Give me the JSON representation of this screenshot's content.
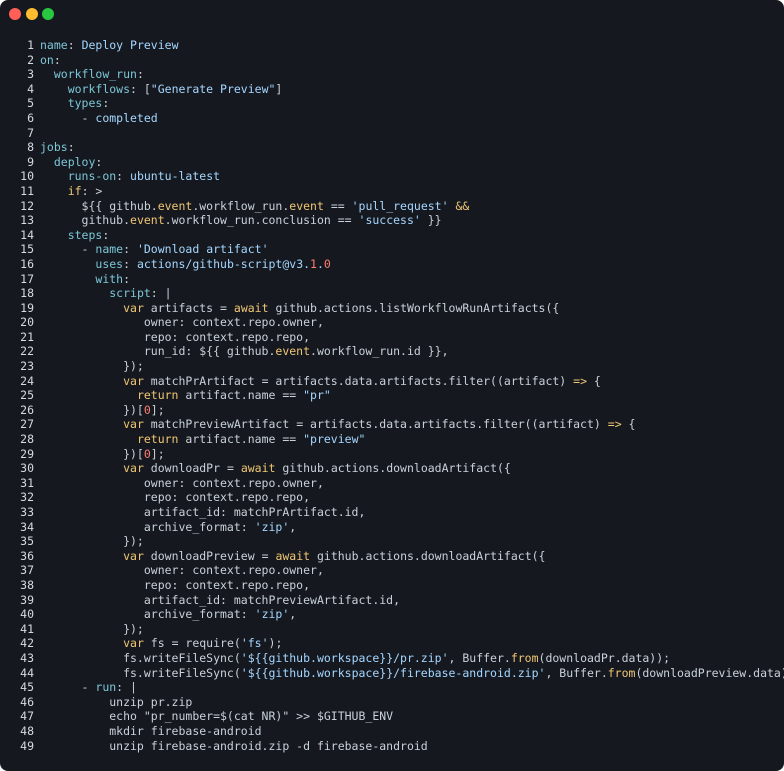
{
  "window": {
    "colors": {
      "background": "#15191f",
      "red": "#ff5f57",
      "yellow": "#febc2e",
      "green": "#28c840"
    }
  },
  "code": {
    "language": "yaml",
    "lines": [
      [
        [
          "k",
          "name"
        ],
        [
          "p",
          ": "
        ],
        [
          "s",
          "Deploy Preview"
        ]
      ],
      [
        [
          "k",
          "on"
        ],
        [
          "p",
          ":"
        ]
      ],
      [
        [
          "p",
          "  "
        ],
        [
          "k",
          "workflow_run"
        ],
        [
          "p",
          ":"
        ]
      ],
      [
        [
          "p",
          "    "
        ],
        [
          "k",
          "workflows"
        ],
        [
          "p",
          ": ["
        ],
        [
          "s",
          "\"Generate Preview\""
        ],
        [
          "p",
          "]"
        ]
      ],
      [
        [
          "p",
          "    "
        ],
        [
          "k",
          "types"
        ],
        [
          "p",
          ":"
        ]
      ],
      [
        [
          "p",
          "      - "
        ],
        [
          "s",
          "completed"
        ]
      ],
      [],
      [
        [
          "k",
          "jobs"
        ],
        [
          "p",
          ":"
        ]
      ],
      [
        [
          "p",
          "  "
        ],
        [
          "k",
          "deploy"
        ],
        [
          "p",
          ":"
        ]
      ],
      [
        [
          "p",
          "    "
        ],
        [
          "k",
          "runs-on"
        ],
        [
          "p",
          ": "
        ],
        [
          "s",
          "ubuntu-latest"
        ]
      ],
      [
        [
          "p",
          "    "
        ],
        [
          "kw",
          "if"
        ],
        [
          "p",
          ": >"
        ]
      ],
      [
        [
          "p",
          "      ${{ github."
        ],
        [
          "kw",
          "event"
        ],
        [
          "p",
          ".workflow_run."
        ],
        [
          "kw",
          "event"
        ],
        [
          "p",
          " == "
        ],
        [
          "s",
          "'pull_request'"
        ],
        [
          "p",
          " "
        ],
        [
          "kw",
          "&&"
        ]
      ],
      [
        [
          "p",
          "      github."
        ],
        [
          "kw",
          "event"
        ],
        [
          "p",
          ".workflow_run.conclusion == "
        ],
        [
          "s",
          "'success'"
        ],
        [
          "p",
          " }}"
        ]
      ],
      [
        [
          "p",
          "    "
        ],
        [
          "k",
          "steps"
        ],
        [
          "p",
          ":"
        ]
      ],
      [
        [
          "p",
          "      - "
        ],
        [
          "k",
          "name"
        ],
        [
          "p",
          ": "
        ],
        [
          "s",
          "'Download artifact'"
        ]
      ],
      [
        [
          "p",
          "        "
        ],
        [
          "k",
          "uses"
        ],
        [
          "p",
          ": "
        ],
        [
          "s",
          "actions/github-script@v3."
        ],
        [
          "n",
          "1"
        ],
        [
          "s",
          "."
        ],
        [
          "n",
          "0"
        ]
      ],
      [
        [
          "p",
          "        "
        ],
        [
          "k",
          "with"
        ],
        [
          "p",
          ":"
        ]
      ],
      [
        [
          "p",
          "          "
        ],
        [
          "k",
          "script"
        ],
        [
          "p",
          ": |"
        ]
      ],
      [
        [
          "p",
          "            "
        ],
        [
          "kw",
          "var"
        ],
        [
          "p",
          " artifacts = "
        ],
        [
          "kw",
          "await"
        ],
        [
          "p",
          " github.actions.listWorkflowRunArtifacts({"
        ]
      ],
      [
        [
          "p",
          "               owner: context.repo.owner,"
        ]
      ],
      [
        [
          "p",
          "               repo: context.repo.repo,"
        ]
      ],
      [
        [
          "p",
          "               run_id: ${{ github."
        ],
        [
          "kw",
          "event"
        ],
        [
          "p",
          ".workflow_run.id }},"
        ]
      ],
      [
        [
          "p",
          "            });"
        ]
      ],
      [
        [
          "p",
          "            "
        ],
        [
          "kw",
          "var"
        ],
        [
          "p",
          " matchPrArtifact = artifacts.data.artifacts.filter((artifact) "
        ],
        [
          "kw",
          "=>"
        ],
        [
          "p",
          " {"
        ]
      ],
      [
        [
          "p",
          "              "
        ],
        [
          "kw",
          "return"
        ],
        [
          "p",
          " artifact.name == "
        ],
        [
          "s",
          "\"pr\""
        ]
      ],
      [
        [
          "p",
          "            })["
        ],
        [
          "n",
          "0"
        ],
        [
          "p",
          "];"
        ]
      ],
      [
        [
          "p",
          "            "
        ],
        [
          "kw",
          "var"
        ],
        [
          "p",
          " matchPreviewArtifact = artifacts.data.artifacts.filter((artifact) "
        ],
        [
          "kw",
          "=>"
        ],
        [
          "p",
          " {"
        ]
      ],
      [
        [
          "p",
          "              "
        ],
        [
          "kw",
          "return"
        ],
        [
          "p",
          " artifact.name == "
        ],
        [
          "s",
          "\"preview\""
        ]
      ],
      [
        [
          "p",
          "            })["
        ],
        [
          "n",
          "0"
        ],
        [
          "p",
          "];"
        ]
      ],
      [
        [
          "p",
          "            "
        ],
        [
          "kw",
          "var"
        ],
        [
          "p",
          " downloadPr = "
        ],
        [
          "kw",
          "await"
        ],
        [
          "p",
          " github.actions.downloadArtifact({"
        ]
      ],
      [
        [
          "p",
          "               owner: context.repo.owner,"
        ]
      ],
      [
        [
          "p",
          "               repo: context.repo.repo,"
        ]
      ],
      [
        [
          "p",
          "               artifact_id: matchPrArtifact.id,"
        ]
      ],
      [
        [
          "p",
          "               archive_format: "
        ],
        [
          "s",
          "'zip'"
        ],
        [
          "p",
          ","
        ]
      ],
      [
        [
          "p",
          "            });"
        ]
      ],
      [
        [
          "p",
          "            "
        ],
        [
          "kw",
          "var"
        ],
        [
          "p",
          " downloadPreview = "
        ],
        [
          "kw",
          "await"
        ],
        [
          "p",
          " github.actions.downloadArtifact({"
        ]
      ],
      [
        [
          "p",
          "               owner: context.repo.owner,"
        ]
      ],
      [
        [
          "p",
          "               repo: context.repo.repo,"
        ]
      ],
      [
        [
          "p",
          "               artifact_id: matchPreviewArtifact.id,"
        ]
      ],
      [
        [
          "p",
          "               archive_format: "
        ],
        [
          "s",
          "'zip'"
        ],
        [
          "p",
          ","
        ]
      ],
      [
        [
          "p",
          "            });"
        ]
      ],
      [
        [
          "p",
          "            "
        ],
        [
          "kw",
          "var"
        ],
        [
          "p",
          " fs = require("
        ],
        [
          "s",
          "'fs'"
        ],
        [
          "p",
          ");"
        ]
      ],
      [
        [
          "p",
          "            fs.writeFileSync("
        ],
        [
          "s",
          "'${{github.workspace}}/pr.zip'"
        ],
        [
          "p",
          ", Buffer."
        ],
        [
          "kw",
          "from"
        ],
        [
          "p",
          "(downloadPr.data));"
        ]
      ],
      [
        [
          "p",
          "            fs.writeFileSync("
        ],
        [
          "s",
          "'${{github.workspace}}/firebase-android.zip'"
        ],
        [
          "p",
          ", Buffer."
        ],
        [
          "kw",
          "from"
        ],
        [
          "p",
          "(downloadPreview.data));"
        ]
      ],
      [
        [
          "p",
          "      - "
        ],
        [
          "k",
          "run"
        ],
        [
          "p",
          ": |"
        ]
      ],
      [
        [
          "p",
          "          unzip pr.zip"
        ]
      ],
      [
        [
          "p",
          "          echo \"pr_number=$(cat NR)\" >> $GITHUB_ENV"
        ]
      ],
      [
        [
          "p",
          "          mkdir firebase-android"
        ]
      ],
      [
        [
          "p",
          "          unzip firebase-android.zip -d firebase-android"
        ]
      ]
    ]
  }
}
